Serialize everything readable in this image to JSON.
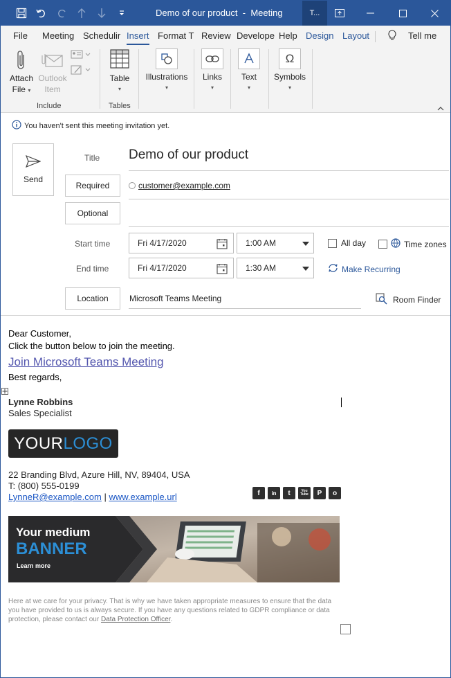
{
  "window": {
    "title": "Demo of our product",
    "title_sep": "-",
    "title_kind": "Meeting",
    "active_tab_label": "T..."
  },
  "menu": {
    "tabs": [
      {
        "label": "File"
      },
      {
        "label": "Meeting"
      },
      {
        "label": "Schedulir"
      },
      {
        "label": "Insert"
      },
      {
        "label": "Format T"
      },
      {
        "label": "Review"
      },
      {
        "label": "Develope"
      },
      {
        "label": "Help"
      },
      {
        "label": "Design"
      },
      {
        "label": "Layout"
      }
    ],
    "tell_me": "Tell me"
  },
  "ribbon": {
    "attach_file": [
      "Attach",
      "File"
    ],
    "outlook_item": [
      "Outlook",
      "Item"
    ],
    "table": "Table",
    "illustrations": "Illustrations",
    "links": "Links",
    "text": "Text",
    "symbols": "Symbols",
    "groups": {
      "include": "Include",
      "tables": "Tables"
    }
  },
  "info": {
    "message": "You haven't sent this meeting invitation yet."
  },
  "form": {
    "send": "Send",
    "title_label": "Title",
    "title_value": "Demo of our product",
    "required_label": "Required",
    "required_value": "customer@example.com",
    "optional_label": "Optional",
    "start_label": "Start time",
    "start_date": "Fri 4/17/2020",
    "start_time": "1:00 AM",
    "end_label": "End time",
    "end_date": "Fri 4/17/2020",
    "end_time": "1:30 AM",
    "all_day": "All day",
    "time_zones": "Time zones",
    "make_recurring": "Make Recurring",
    "location_label": "Location",
    "location_value": "Microsoft Teams Meeting",
    "room_finder": "Room Finder"
  },
  "body": {
    "greeting": "Dear Customer,",
    "instruction": "Click the button below to join the meeting.",
    "join_link": "Join Microsoft Teams Meeting",
    "closing": "Best regards,",
    "name": "Lynne Robbins",
    "position": "Sales Specialist",
    "logo_a": "YOUR",
    "logo_b": "LOGO",
    "address": "22 Branding Blvd, Azure Hill, NV, 89404, USA",
    "phone": "T: (800) 555-0199",
    "email": "LynneR@example.com",
    "link_sep": "|",
    "website": "www.example.url",
    "banner_line1": "Your medium",
    "banner_line2": "BANNER",
    "banner_cta": "Learn more",
    "privacy_text": "Here at we care for your privacy. That is why we have taken appropriate measures to ensure that the data you have provided to us is always secure. If you have any questions related to GDPR compliance or data protection, please contact our",
    "privacy_link": "Data Protection Officer",
    "privacy_end": "."
  },
  "social": [
    {
      "icon": "facebook-icon",
      "glyph": "f"
    },
    {
      "icon": "linkedin-icon",
      "glyph": "in"
    },
    {
      "icon": "twitter-icon",
      "glyph": "t"
    },
    {
      "icon": "youtube-icon",
      "glyph": "You Tube"
    },
    {
      "icon": "pinterest-icon",
      "glyph": "P"
    },
    {
      "icon": "instagram-icon",
      "glyph": "o"
    }
  ],
  "colors": {
    "accent": "#2b579a",
    "link": "#1a56c4",
    "join_link": "#5558af",
    "banner_blue": "#2c8fd6"
  }
}
